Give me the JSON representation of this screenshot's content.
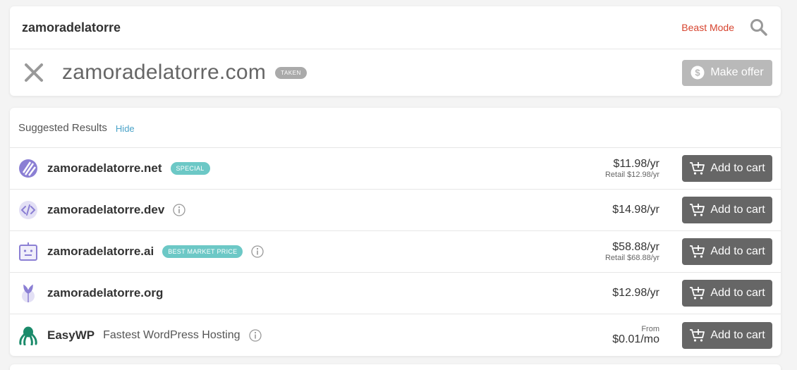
{
  "search": {
    "query": "zamoradelatorre",
    "beast_mode": "Beast Mode"
  },
  "primary_result": {
    "domain": "zamoradelatorre.com",
    "status": "TAKEN",
    "action": "Make offer"
  },
  "suggested": {
    "title": "Suggested Results",
    "hide": "Hide",
    "rows": [
      {
        "domain": "zamoradelatorre.net",
        "badge": "SPECIAL",
        "price": "$11.98/yr",
        "retail": "Retail $12.98/yr",
        "action": "Add to cart",
        "icon": "net-tld-icon"
      },
      {
        "domain": "zamoradelatorre.dev",
        "price": "$14.98/yr",
        "action": "Add to cart",
        "icon": "dev-tld-icon"
      },
      {
        "domain": "zamoradelatorre.ai",
        "badge": "BEST MARKET PRICE",
        "price": "$58.88/yr",
        "retail": "Retail $68.88/yr",
        "action": "Add to cart",
        "icon": "ai-tld-icon"
      },
      {
        "domain": "zamoradelatorre.org",
        "price": "$12.98/yr",
        "action": "Add to cart",
        "icon": "org-tld-icon"
      },
      {
        "domain": "EasyWP",
        "subtitle": "Fastest WordPress Hosting",
        "from": "From",
        "price": "$0.01/mo",
        "action": "Add to cart",
        "icon": "easywp-octopus-icon"
      }
    ]
  },
  "colors": {
    "accent_red": "#d7442f",
    "link_blue": "#4aa3c8",
    "badge_teal": "#6cc8c6",
    "button_gray": "#666666",
    "icon_purple": "#8b7fd4",
    "easywp_green": "#1a8a6a"
  }
}
